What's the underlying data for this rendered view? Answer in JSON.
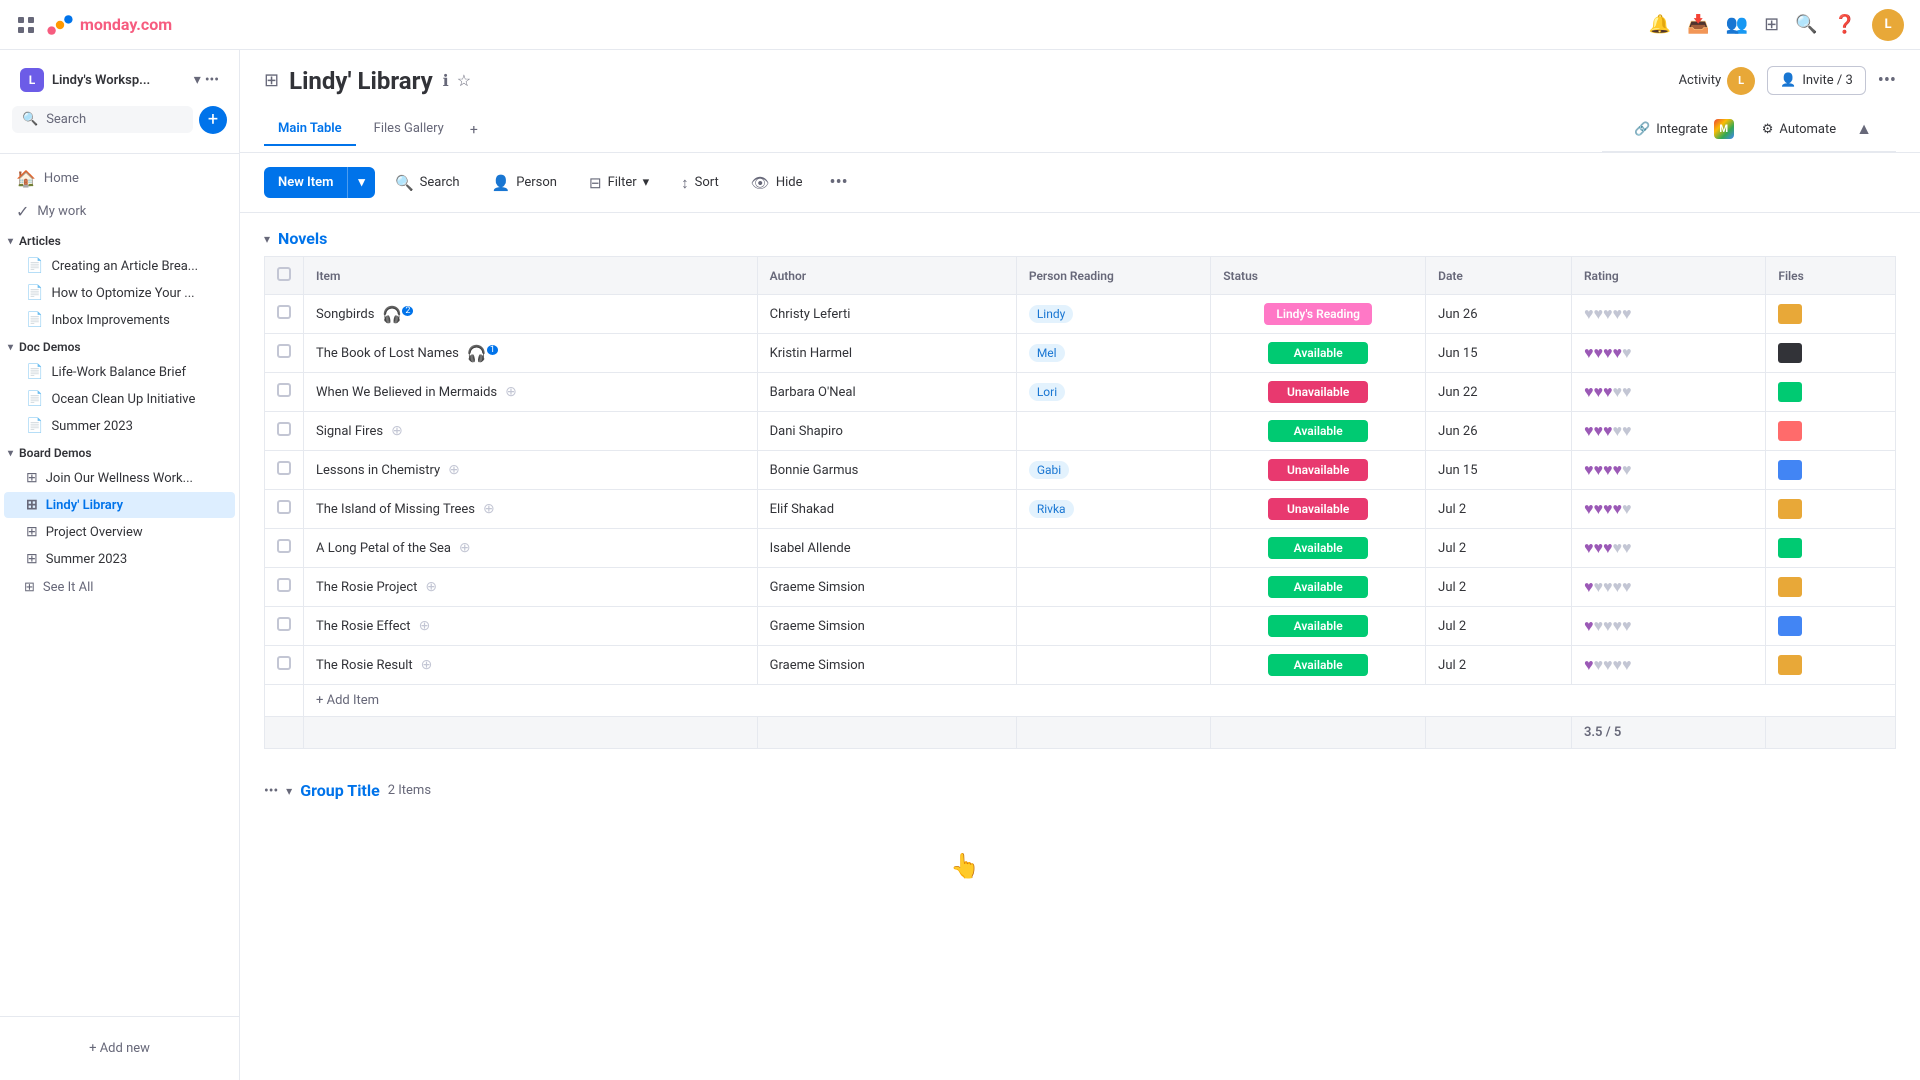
{
  "app": {
    "name": "monday.com"
  },
  "topNav": {
    "logo": "monday.com",
    "icons": [
      "grid",
      "bell",
      "inbox",
      "people",
      "apps",
      "search",
      "help",
      "account"
    ]
  },
  "sidebar": {
    "workspace": {
      "badge": "L",
      "name": "Lindy's Worksp...",
      "color": "#6c5ce7"
    },
    "search_placeholder": "Search",
    "nav_items": [
      {
        "label": "Home",
        "icon": "🏠"
      },
      {
        "label": "My work",
        "icon": "✓"
      }
    ],
    "sections": [
      {
        "name": "Articles",
        "items": [
          {
            "label": "Creating an Article Brea...",
            "icon": "📄",
            "active": false
          },
          {
            "label": "How to Optomize Your ...",
            "icon": "📄",
            "active": false
          },
          {
            "label": "Inbox Improvements",
            "icon": "📄",
            "active": false
          }
        ]
      },
      {
        "name": "Doc Demos",
        "items": [
          {
            "label": "Life-Work Balance Brief",
            "icon": "📄",
            "active": false
          },
          {
            "label": "Ocean Clean Up Initiative",
            "icon": "📄",
            "active": false
          },
          {
            "label": "Summer 2023",
            "icon": "📄",
            "active": false
          }
        ]
      },
      {
        "name": "Board Demos",
        "items": [
          {
            "label": "Join Our Wellness Work...",
            "icon": "⊞",
            "active": false
          },
          {
            "label": "Lindy' Library",
            "icon": "⊞",
            "active": true
          },
          {
            "label": "Project Overview",
            "icon": "⊞",
            "active": false
          },
          {
            "label": "Summer 2023",
            "icon": "⊞",
            "active": false
          }
        ]
      }
    ],
    "see_it_all": "See It All",
    "add_new": "+ Add new"
  },
  "board": {
    "title": "Lindy' Library",
    "tabs": [
      {
        "label": "Main Table",
        "active": true
      },
      {
        "label": "Files Gallery",
        "active": false
      }
    ],
    "activity": "Activity",
    "invite": "Invite / 3",
    "integrate": "Integrate",
    "automate": "Automate",
    "toolbar": {
      "new_item": "New Item",
      "search": "Search",
      "person": "Person",
      "filter": "Filter",
      "sort": "Sort",
      "hide": "Hide"
    }
  },
  "table": {
    "group1": {
      "name": "Novels",
      "color": "#0073ea",
      "columns": [
        "Item",
        "Author",
        "Person Reading",
        "Status",
        "Date",
        "Rating",
        "Files"
      ],
      "rows": [
        {
          "item": "Songbirds",
          "has_audio": true,
          "audio_count": 2,
          "author": "Christy Leferti",
          "person": "Lindy",
          "status": "Lindy's Reading",
          "status_type": "reading",
          "date": "Jun 26",
          "rating": 0,
          "rating_max": 5
        },
        {
          "item": "The Book of Lost Names",
          "has_audio": true,
          "audio_count": 1,
          "author": "Kristin Harmel",
          "person": "Mel",
          "status": "Available",
          "status_type": "available",
          "date": "Jun 15",
          "rating": 4,
          "rating_max": 5
        },
        {
          "item": "When We Believed in Mermaids",
          "has_audio": false,
          "author": "Barbara O'Neal",
          "person": "Lori",
          "status": "Unavailable",
          "status_type": "unavailable",
          "date": "Jun 22",
          "rating": 3,
          "rating_max": 5
        },
        {
          "item": "Signal Fires",
          "has_audio": false,
          "author": "Dani Shapiro",
          "person": "",
          "status": "Available",
          "status_type": "available",
          "date": "Jun 26",
          "rating": 3,
          "rating_max": 5
        },
        {
          "item": "Lessons in Chemistry",
          "has_audio": false,
          "author": "Bonnie Garmus",
          "person": "Gabi",
          "status": "Unavailable",
          "status_type": "unavailable",
          "date": "Jun 15",
          "rating": 4,
          "rating_max": 5
        },
        {
          "item": "The Island of Missing Trees",
          "has_audio": false,
          "author": "Elif Shakad",
          "person": "Rivka",
          "status": "Unavailable",
          "status_type": "unavailable",
          "date": "Jul 2",
          "rating": 4,
          "rating_max": 5
        },
        {
          "item": "A Long Petal of the Sea",
          "has_audio": false,
          "author": "Isabel Allende",
          "person": "",
          "status": "Available",
          "status_type": "available",
          "date": "Jul 2",
          "rating": 3,
          "rating_max": 5
        },
        {
          "item": "The Rosie Project",
          "has_audio": false,
          "author": "Graeme Simsion",
          "person": "",
          "status": "Available",
          "status_type": "available",
          "date": "Jul 2",
          "rating": 1,
          "rating_max": 5
        },
        {
          "item": "The Rosie Effect",
          "has_audio": false,
          "author": "Graeme Simsion",
          "person": "",
          "status": "Available",
          "status_type": "available",
          "date": "Jul 2",
          "rating": 1,
          "rating_max": 5
        },
        {
          "item": "The Rosie Result",
          "has_audio": false,
          "author": "Graeme Simsion",
          "person": "",
          "status": "Available",
          "status_type": "available",
          "date": "Jul 2",
          "rating": 1,
          "rating_max": 5
        }
      ],
      "summary": {
        "rating": "3.5 / 5"
      },
      "add_item": "+ Add Item"
    },
    "group2": {
      "name": "Group Title",
      "count": "2 Items"
    }
  }
}
